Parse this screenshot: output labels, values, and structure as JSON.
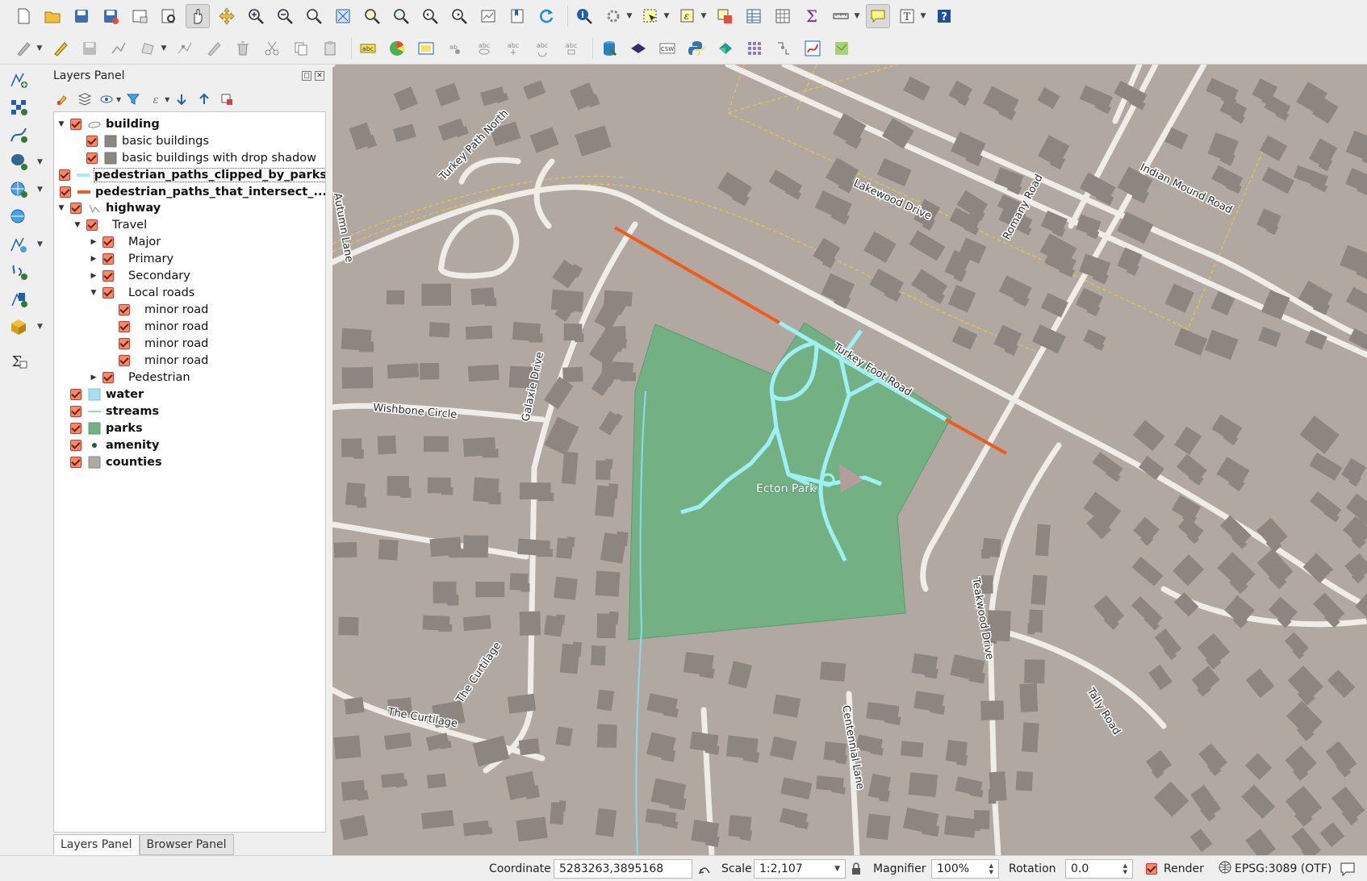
{
  "layers_panel": {
    "title": "Layers Panel",
    "tree": [
      {
        "label": "building",
        "bold": true,
        "arrow": "down",
        "symbol": "building-group",
        "indent": 0
      },
      {
        "label": "basic buildings",
        "bold": false,
        "arrow": "",
        "symbol": "fill-gray",
        "indent": 1
      },
      {
        "label": "basic buildings with drop shadow",
        "bold": false,
        "arrow": "",
        "symbol": "fill-gray",
        "indent": 1
      },
      {
        "label": "pedestrian_paths_clipped_by_parks",
        "bold": true,
        "arrow": "",
        "symbol": "line-cyan",
        "indent": 0,
        "selected": true
      },
      {
        "label": "pedestrian_paths_that_intersect_...",
        "bold": true,
        "arrow": "",
        "symbol": "line-orange",
        "indent": 0
      },
      {
        "label": "highway",
        "bold": true,
        "arrow": "down",
        "symbol": "line-group",
        "indent": 0
      },
      {
        "label": "Travel",
        "bold": false,
        "arrow": "down",
        "symbol": "none",
        "indent": 1
      },
      {
        "label": "Major",
        "bold": false,
        "arrow": "right",
        "symbol": "none",
        "indent": 2
      },
      {
        "label": "Primary",
        "bold": false,
        "arrow": "right",
        "symbol": "none",
        "indent": 2
      },
      {
        "label": "Secondary",
        "bold": false,
        "arrow": "right",
        "symbol": "none",
        "indent": 2
      },
      {
        "label": "Local roads",
        "bold": false,
        "arrow": "down",
        "symbol": "none",
        "indent": 2
      },
      {
        "label": "minor road",
        "bold": false,
        "arrow": "",
        "symbol": "none",
        "indent": 3
      },
      {
        "label": "minor road",
        "bold": false,
        "arrow": "",
        "symbol": "none",
        "indent": 3
      },
      {
        "label": "minor road",
        "bold": false,
        "arrow": "",
        "symbol": "none",
        "indent": 3
      },
      {
        "label": "minor road",
        "bold": false,
        "arrow": "",
        "symbol": "none",
        "indent": 3
      },
      {
        "label": "Pedestrian",
        "bold": false,
        "arrow": "right",
        "symbol": "none",
        "indent": 2
      },
      {
        "label": "water",
        "bold": true,
        "arrow": "",
        "symbol": "fill-water",
        "indent": 0
      },
      {
        "label": "streams",
        "bold": true,
        "arrow": "",
        "symbol": "line-stream",
        "indent": 0
      },
      {
        "label": "parks",
        "bold": true,
        "arrow": "",
        "symbol": "fill-park",
        "indent": 0
      },
      {
        "label": "amenity",
        "bold": true,
        "arrow": "",
        "symbol": "dot",
        "indent": 0
      },
      {
        "label": "counties",
        "bold": true,
        "arrow": "",
        "symbol": "fill-county",
        "indent": 0
      }
    ],
    "tabs": [
      "Layers Panel",
      "Browser Panel"
    ]
  },
  "map": {
    "labels": {
      "turkey_path_north": "Turkey Path North",
      "lakewood": "Lakewood Drive",
      "indian_mound": "Indian Mound Road",
      "romany": "Romany Road",
      "autumn": "Autumn Lane",
      "turkey_foot": "Turkey Foot Road",
      "galaxie": "Galaxie Drive",
      "wishbone": "Wishbone Circle",
      "ecton": "Ecton Park",
      "teakwood": "Teakwood Drive",
      "curtilage1": "The Curtilage",
      "curtilage2": "The Curtilage",
      "centennial": "Centennial Lane",
      "tally": "Tally Road"
    },
    "colors": {
      "background": "#b1a9a1",
      "building": "#8d8580",
      "road": "#f0ece8",
      "park": "#73b185",
      "path_clipped": "#9ff0f2",
      "path_intersect": "#f25a1a",
      "stream": "#8fd8ec",
      "boundary": "#e8c547"
    }
  },
  "statusbar": {
    "coordinate_label": "Coordinate",
    "coordinate_value": "5283263,3895168",
    "scale_label": "Scale",
    "scale_value": "1:2,107",
    "magnifier_label": "Magnifier",
    "magnifier_value": "100%",
    "rotation_label": "Rotation",
    "rotation_value": "0.0",
    "render_label": "Render",
    "crs": "EPSG:3089 (OTF)"
  }
}
